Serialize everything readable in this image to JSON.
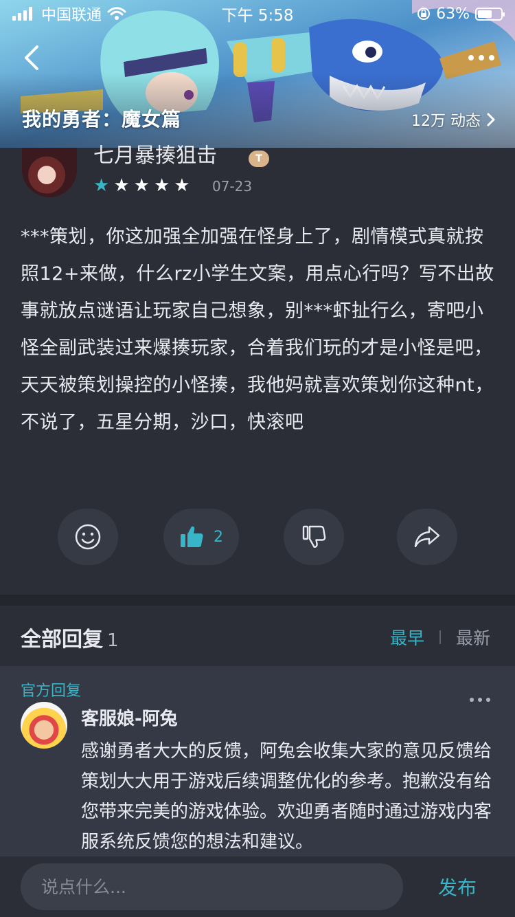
{
  "status_bar": {
    "carrier": "中国联通",
    "time": "下午 5:58",
    "battery": "63%",
    "battery_level": 0.63
  },
  "header": {
    "game_title": "我的勇者：魔女篇",
    "meta": "12万 动态"
  },
  "review": {
    "user_name": "七月暴揍狙击",
    "level_badge": "T",
    "rating": 1,
    "rating_max": 5,
    "date": "07-23",
    "content": "***策划，你这加强全加强在怪身上了，剧情模式真就按照12+来做，什么rz小学生文案，用点心行吗？写不出故事就放点谜语让玩家自己想象，别***虾扯行么，寄吧小怪全副武装过来爆揍玩家，合着我们玩的才是小怪是吧，天天被策划操控的小怪揍，我他妈就喜欢策划你这种nt，不说了，五星分期，沙口，快滚吧",
    "like_count": "2"
  },
  "replies": {
    "title": "全部回复",
    "count": "1",
    "sort_earliest": "最早",
    "sort_latest": "最新",
    "items": [
      {
        "tag": "官方回复",
        "name": "客服娘-阿兔",
        "text": "感谢勇者大大的反馈，阿兔会收集大家的意见反馈给策划大大用于游戏后续调整优化的参考。抱歉没有给您带来完美的游戏体验。欢迎勇者随时通过游戏内客服系统反馈您的想法和建议。"
      }
    ]
  },
  "composer": {
    "placeholder": "说点什么...",
    "publish_label": "发布"
  },
  "colors": {
    "accent": "#38b5c6",
    "background": "#2b2e37",
    "reply_background": "#353945"
  }
}
